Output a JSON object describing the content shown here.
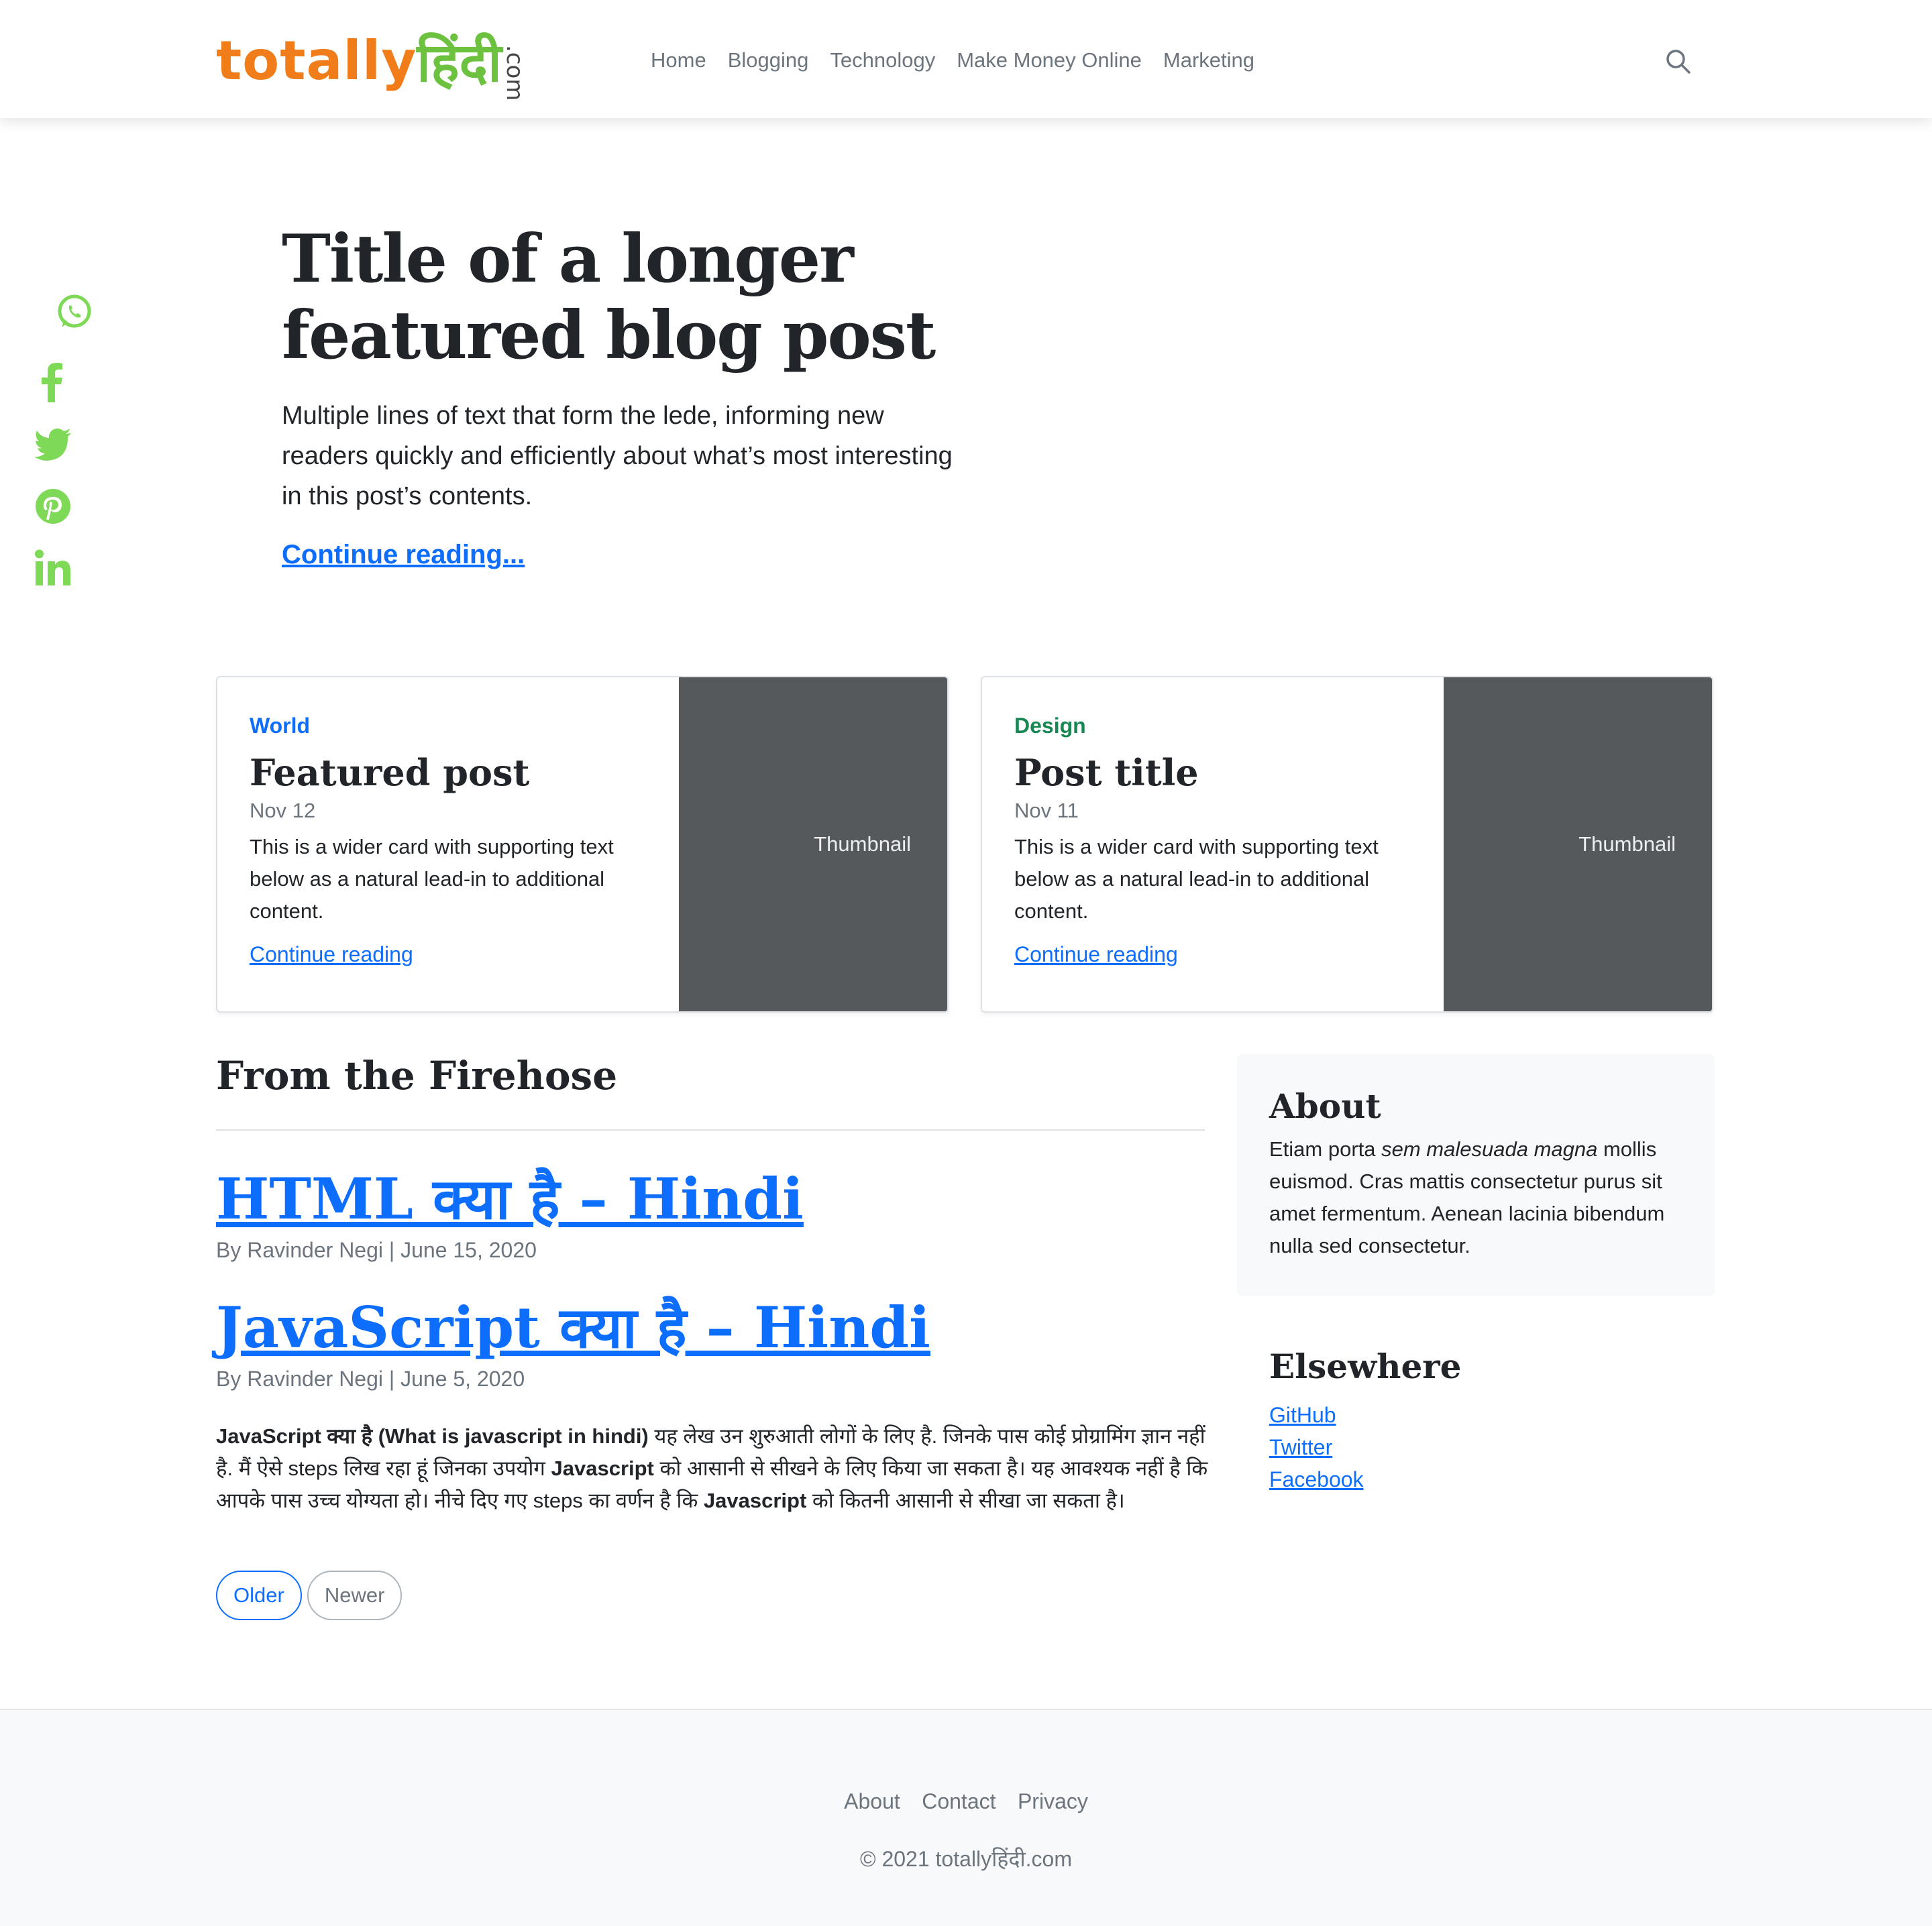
{
  "header": {
    "logo_main": "totally",
    "logo_hindi": "हिंदी",
    "logo_com": ".com",
    "nav": [
      "Home",
      "Blogging",
      "Technology",
      "Make Money Online",
      "Marketing"
    ],
    "search_icon": "search-icon"
  },
  "social": [
    "whatsapp-icon",
    "facebook-icon",
    "twitter-icon",
    "pinterest-icon",
    "linkedin-icon"
  ],
  "colors": {
    "brand_orange": "#f07d1a",
    "brand_green": "#6cc13f",
    "social_green": "#7ed957",
    "link_blue": "#0d6efd",
    "category_design": "#198754",
    "thumb_bg": "#55595c"
  },
  "hero": {
    "title_line1": "Title of a longer",
    "title_line2": "featured blog post",
    "lede_line1": "Multiple lines of text that form the lede, informing new",
    "lede_line2": "readers quickly and efficiently about what’s most interesting",
    "lede_line3": "in this post’s contents.",
    "link": "Continue reading..."
  },
  "cards": [
    {
      "category": "World",
      "title": "Featured post",
      "date": "Nov 12",
      "text_line1": "This is a wider card with supporting text",
      "text_line2": "below as a natural lead-in to additional",
      "text_line3": "content.",
      "link": "Continue reading",
      "thumb": "Thumbnail"
    },
    {
      "category": "Design",
      "title": "Post title",
      "date": "Nov 11",
      "text_line1": "This is a wider card with supporting text",
      "text_line2": "below as a natural lead-in to additional",
      "text_line3": "content.",
      "link": "Continue reading",
      "thumb": "Thumbnail"
    }
  ],
  "main": {
    "heading": "From the Firehose",
    "posts": [
      {
        "title": "HTML क्या है – Hindi",
        "meta": "By Ravinder Negi | June 15, 2020"
      },
      {
        "title": "JavaScript क्या है – Hindi",
        "meta": "By Ravinder Negi | June 5, 2020",
        "excerpt": {
          "b1": "JavaScript क्या है (What is javascript in hindi)",
          "t1": " यह लेख उन शुरुआती लोगों के लिए है. जिनके पास कोई प्रोग्रामिंग ज्ञान नहीं है. मैं ऐसे steps लिख रहा हूं जिनका उपयोग ",
          "b2": "Javascript",
          "t2": " को आसानी से सीखने के लिए किया जा सकता है। यह आवश्यक नहीं है कि आपके पास उच्च योग्यता हो। नीचे दिए गए steps का वर्णन है कि ",
          "b3": "Javascript",
          "t3": " को कितनी आसानी से सीखा जा सकता है।"
        }
      }
    ],
    "pager": {
      "older": "Older",
      "newer": "Newer"
    }
  },
  "sidebar": {
    "about_title": "About",
    "about_text_1": "Etiam porta ",
    "about_text_em": "sem malesuada magna",
    "about_text_2": " mollis euismod. Cras mattis consectetur purus sit amet fermentum. Aenean lacinia bibendum nulla sed consectetur.",
    "elsewhere_title": "Elsewhere",
    "elsewhere_links": [
      "GitHub",
      "Twitter",
      "Facebook"
    ]
  },
  "footer": {
    "links": [
      "About",
      "Contact",
      "Privacy"
    ],
    "copyright": "© 2021 totallyहिंदी.com"
  }
}
